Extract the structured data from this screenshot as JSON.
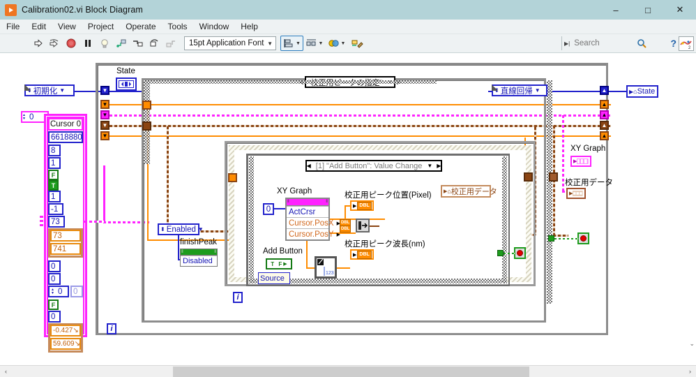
{
  "window": {
    "title": "Calibration02.vi Block Diagram",
    "icon": "labview-run-icon",
    "minimize": "–",
    "maximize": "□",
    "close": "✕"
  },
  "menubar": {
    "items": [
      "File",
      "Edit",
      "View",
      "Project",
      "Operate",
      "Tools",
      "Window",
      "Help"
    ]
  },
  "toolbar": {
    "run": "run-arrow-icon",
    "run_continuously": "run-continuously-icon",
    "abort": "abort-execution-icon",
    "pause": "pause-icon",
    "highlight": "highlight-execution-bulb-icon",
    "retain_values": "retain-wire-values-icon",
    "step_into": "step-into-icon",
    "step_over": "step-over-icon",
    "step_out": "step-out-icon",
    "font": "15pt Application Font",
    "align_objects": "align-objects-icon",
    "distribute_objects": "distribute-objects-icon",
    "resize_objects": "resize-objects-icon",
    "reorder": "reorder-icon",
    "clean_up": "clean-up-diagram-icon",
    "search_placeholder": "Search",
    "search_value": "",
    "search_icon": "magnifier-icon",
    "help_icon": "context-help-icon",
    "ni_icon": "ni-badge-icon"
  },
  "diagram": {
    "state_label": "State",
    "init_enum": "初期化",
    "case_outer_selector": "\"校正用ピークの指定\"",
    "event_selector": "[1] \"Add Button\": Value Change",
    "regression_enum": "直線回帰",
    "state_terminal": "State",
    "enabled_enum": "Enabled",
    "finish_peak_label": "finishPeak",
    "finish_peak_prop": "Disabled",
    "xygraph_label_left": "XY Graph",
    "xygraph_rows": [
      "ActCrsr",
      "Cursor.PosX",
      "Cursor.PosY"
    ],
    "active_cursor_const": "0",
    "peak_pixel_label": "校正用ピーク位置(Pixel)",
    "peak_wavelength_label": "校正用ピーク波長(nm)",
    "add_button_label": "Add Button",
    "add_button_value": "T F",
    "source_label": "Source",
    "calib_data_node": "校正用データ",
    "xygraph_label_right": "XY Graph",
    "calib_data_label_right": "校正用データ",
    "dbl_label": "DBL",
    "iterator": "i",
    "num2str_glyph": "123",
    "cluster": {
      "index_const": "0",
      "title": "Cursor 0",
      "rows": [
        "6618880",
        "8",
        "1"
      ],
      "bool_f": "F",
      "bool_t": "T",
      "rows2": [
        "1",
        "-1",
        "73"
      ],
      "orange_rows": [
        "73",
        "741"
      ],
      "rows3": [
        "0",
        "0"
      ],
      "spin_value": "0",
      "ghost_value": "0",
      "bool_f2": "F",
      "row4": "0",
      "orange_rows2": [
        "-0.427↘",
        "59.609↘"
      ]
    }
  },
  "scrollbars": {
    "left_arrow": "‹",
    "right_arrow": "›",
    "down_arrow": "⌄"
  },
  "colors": {
    "title_bar": "#b3d3d8",
    "toolbar": "#eef2f3",
    "wire_blue": "#2222cc",
    "wire_orange": "#ff8c00",
    "wire_pink": "#ff22ff",
    "wire_brown": "#8b4513",
    "frame_gray": "#8d8d8d",
    "canvas": "#ffffff"
  }
}
